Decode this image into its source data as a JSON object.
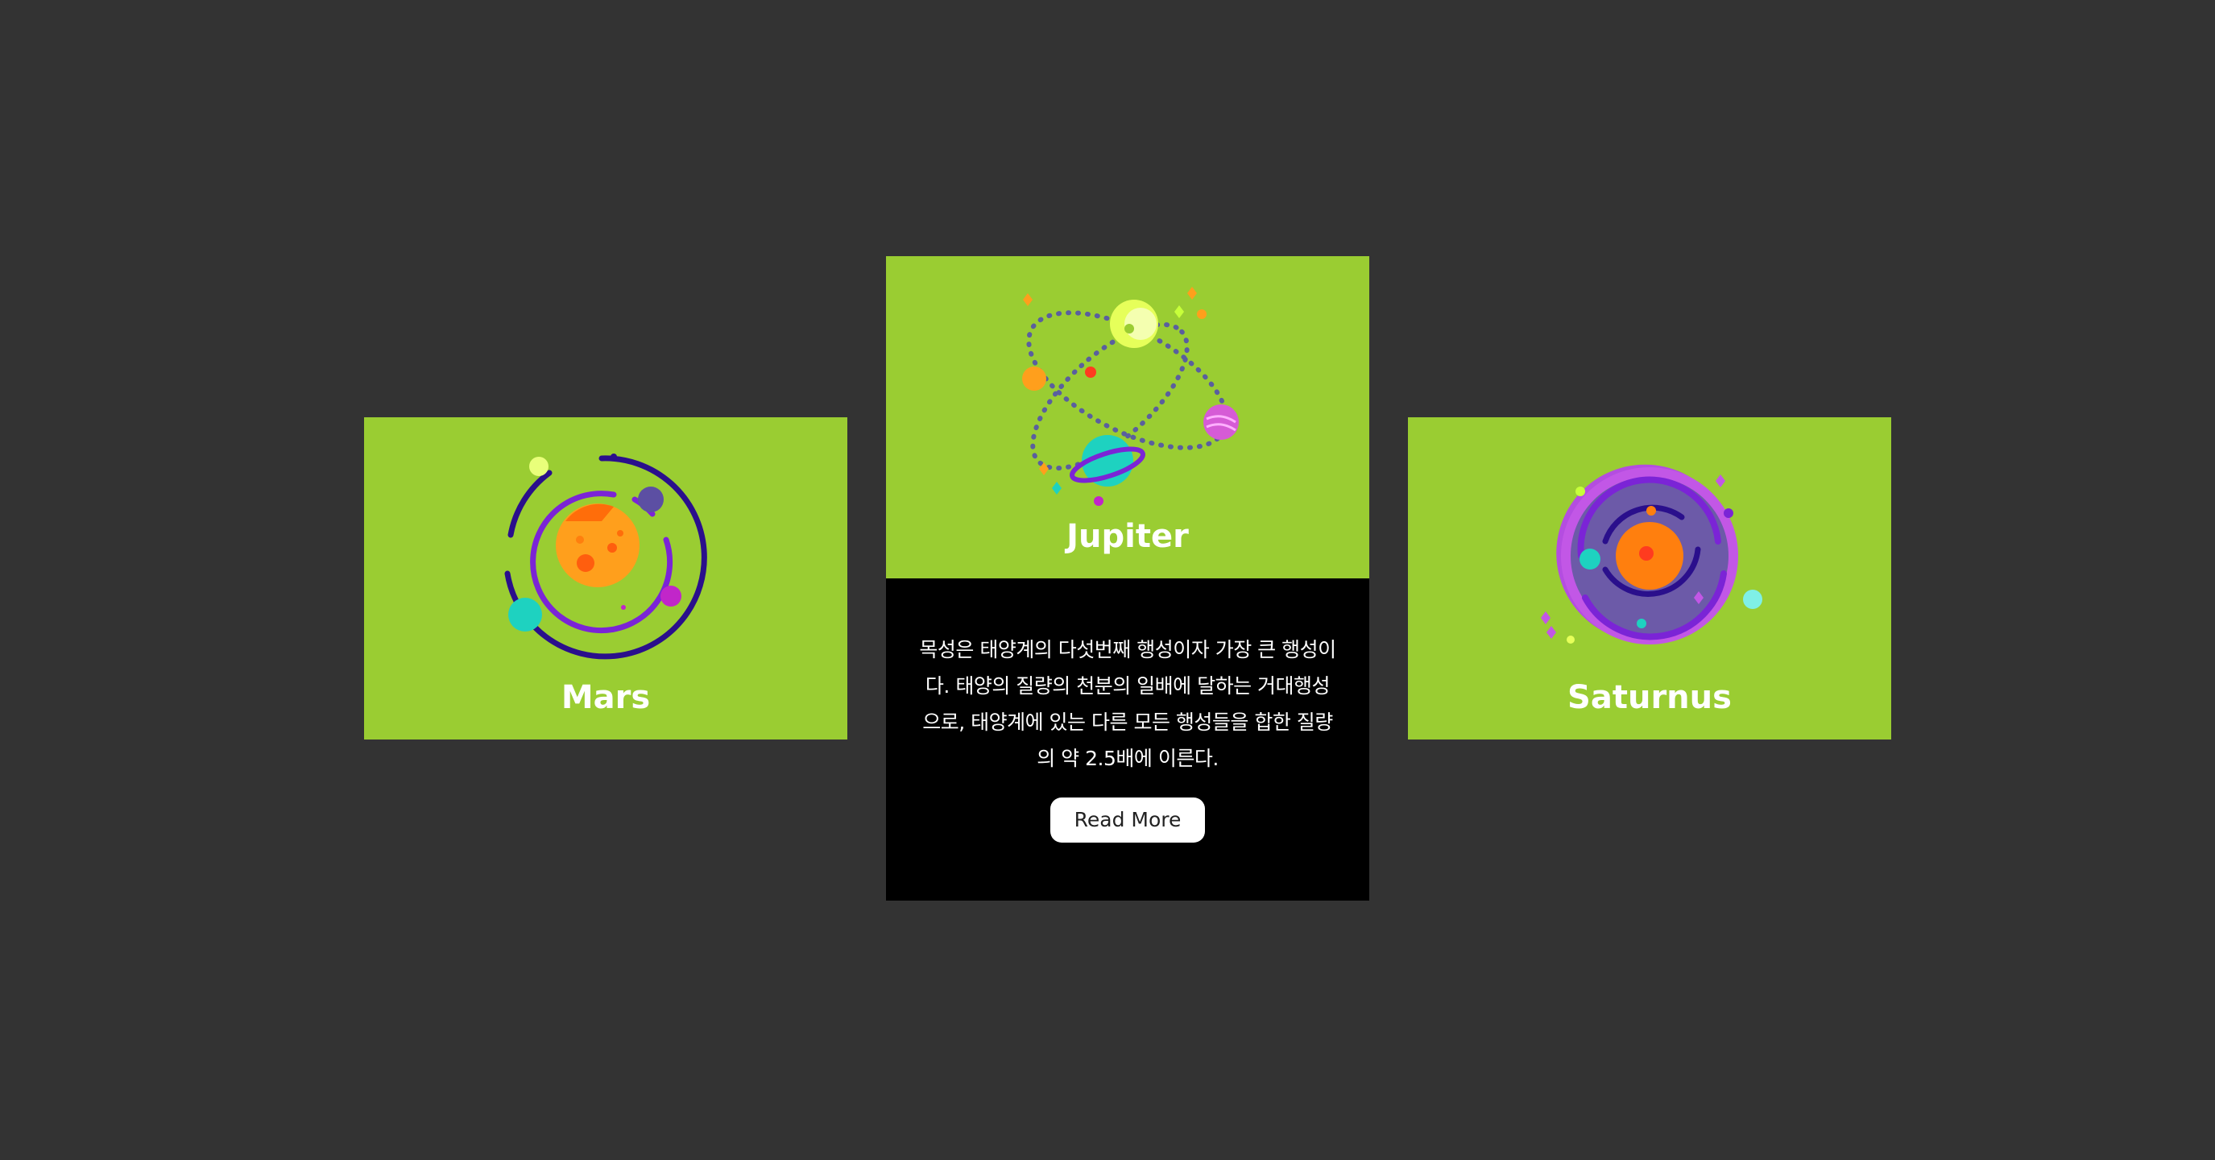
{
  "cards": [
    {
      "title": "Mars",
      "icon": "solar-system-icon"
    },
    {
      "title": "Jupiter",
      "icon": "orbit-planets-icon",
      "description": "목성은 태양계의 다섯번째 행성이자 가장 큰 행성이다. 태양의 질량의 천분의 일배에 달하는 거대행성으로, 태양계에 있는 다른 모든 행성들을 합한 질량의 약 2.5배에 이른다.",
      "button_label": "Read More"
    },
    {
      "title": "Saturnus",
      "icon": "galaxy-vortex-icon"
    }
  ],
  "colors": {
    "background": "#333333",
    "card_face": "#9acd32",
    "card_body": "#000000",
    "button": "#ffffff"
  }
}
